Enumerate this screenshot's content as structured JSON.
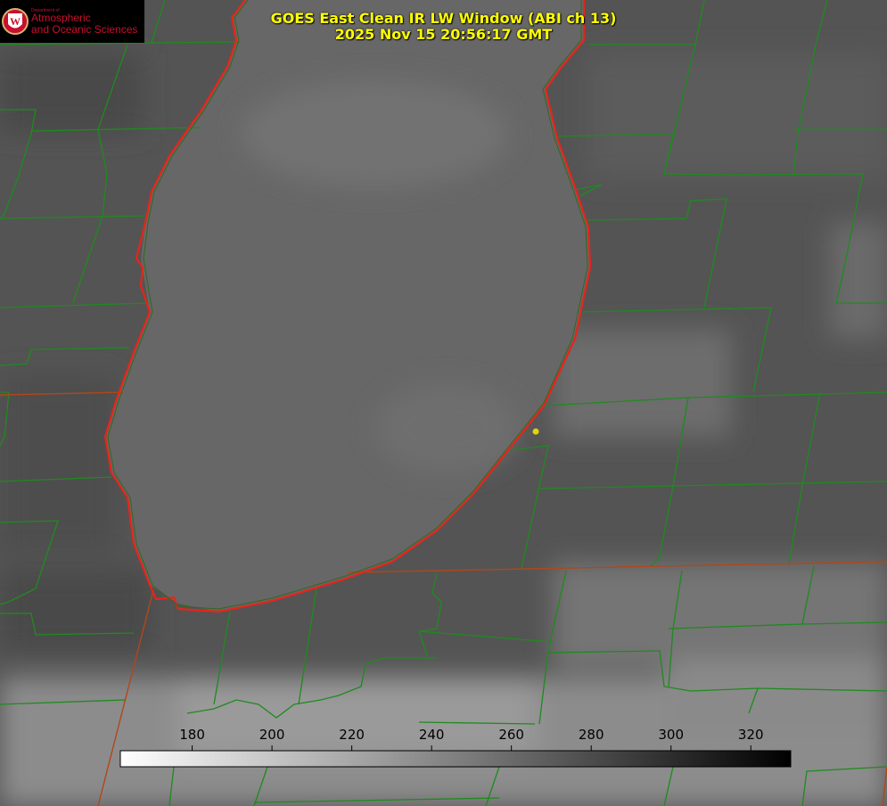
{
  "title": {
    "line1": "GOES East Clean IR LW Window (ABI ch 13)",
    "line2": "2025 Nov 15 20:56:17 GMT"
  },
  "logo": {
    "department": "Department of",
    "name_line1": "Atmospheric",
    "name_line2": "and Oceanic Sciences",
    "seal_letter": "W"
  },
  "colorbar": {
    "ticks": [
      "180",
      "200",
      "220",
      "240",
      "260",
      "280",
      "300",
      "320"
    ],
    "tick_values": [
      180,
      200,
      220,
      240,
      260,
      280,
      300,
      320
    ],
    "range": [
      162,
      330
    ],
    "gradient_from": "#ffffff",
    "gradient_to": "#000000"
  },
  "map": {
    "lake_outline_color": "#e8231b",
    "county_line_color": "#1f8a1f",
    "state_line_color": "#b0471a",
    "marker_color": "#e6d400",
    "background_color": "#555555"
  }
}
